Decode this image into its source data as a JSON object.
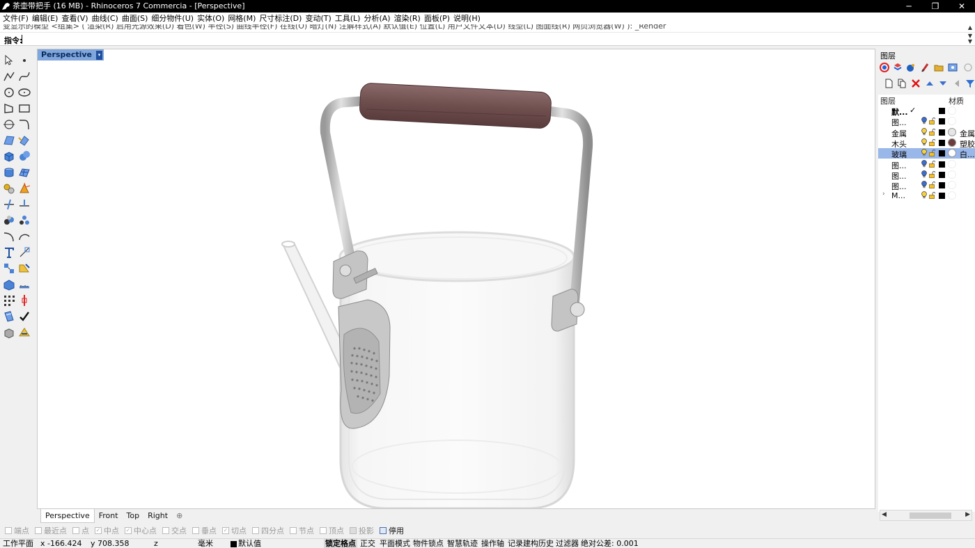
{
  "window": {
    "title": "茶壶带把手 (16 MB) - Rhinoceros 7 Commercia - [Perspective]",
    "controls": {
      "minimize": "─",
      "maximize": "❐",
      "close": "✕"
    }
  },
  "menu": [
    "文件(F)",
    "编辑(E)",
    "查看(V)",
    "曲线(C)",
    "曲面(S)",
    "细分物件(U)",
    "实体(O)",
    "网格(M)",
    "尺寸标注(D)",
    "变动(T)",
    "工具(L)",
    "分析(A)",
    "渲染(R)",
    "面板(P)",
    "说明(H)"
  ],
  "command": {
    "history": "变显示的模型 <组集> ( 渲染(R) 启用光源效果(D) 着色(W) 半径(S) 曲线半径(F) 在线(O) 暗灯(N) 注解样式(A) 默认值(E) 位置(L) 用户文件文本(D) 线型(L) 图面线(R) 网页浏览器(W) ): _Render",
    "prompt_label": "指令:"
  },
  "viewport": {
    "name": "Perspective",
    "menu_arrow": "▾"
  },
  "viewport_tabs": {
    "tabs": [
      "Perspective",
      "Front",
      "Top",
      "Right"
    ],
    "add": "⊕"
  },
  "osnap": [
    {
      "label": "端点",
      "checked": false
    },
    {
      "label": "最近点",
      "checked": false
    },
    {
      "label": "点",
      "checked": false
    },
    {
      "label": "中点",
      "checked": true
    },
    {
      "label": "中心点",
      "checked": true
    },
    {
      "label": "交点",
      "checked": false
    },
    {
      "label": "垂点",
      "checked": false
    },
    {
      "label": "切点",
      "checked": true
    },
    {
      "label": "四分点",
      "checked": false
    },
    {
      "label": "节点",
      "checked": false
    },
    {
      "label": "顶点",
      "checked": false
    },
    {
      "label": "投影",
      "checked": false
    },
    {
      "label": "停用",
      "checked": false,
      "enabled": true
    }
  ],
  "status": {
    "cplane": "工作平面",
    "x": "x -166.424",
    "y": "y 708.358",
    "z": "z",
    "unit": "毫米",
    "layer": "默认值",
    "toggles": [
      "锁定格点",
      "正交",
      "平面模式",
      "物件锁点",
      "智慧轨迹",
      "操作轴",
      "记录建构历史",
      "过滤器"
    ],
    "active_toggle": "锁定格点",
    "tolerance": "绝对公差: 0.001"
  },
  "layers_panel": {
    "title": "图层",
    "col_layer": "图层",
    "col_material": "材质",
    "layers": [
      {
        "name": "默...",
        "current": true,
        "check": "✓",
        "bulb_on": false,
        "color": "#000000",
        "material": "",
        "mat_color": "",
        "bold": true
      },
      {
        "name": "图...",
        "bulb_on": true,
        "color": "#000000",
        "material": "",
        "mat_color": ""
      },
      {
        "name": "金属",
        "bulb_on": false,
        "color": "#000000",
        "material": "金属",
        "mat_color": "#e6e6e6"
      },
      {
        "name": "木头",
        "bulb_on": false,
        "color": "#000000",
        "material": "塑胶",
        "mat_color": "#6b3c3c"
      },
      {
        "name": "玻璃",
        "bulb_on": false,
        "color": "#000000",
        "material": "白...",
        "mat_color": "#ffffff",
        "selected": true
      },
      {
        "name": "图...",
        "bulb_on": true,
        "color": "#000000",
        "material": "",
        "mat_color": ""
      },
      {
        "name": "图...",
        "bulb_on": true,
        "color": "#000000",
        "material": "",
        "mat_color": ""
      },
      {
        "name": "图...",
        "bulb_on": true,
        "color": "#000000",
        "material": "",
        "mat_color": ""
      },
      {
        "name": "M...",
        "bulb_on": false,
        "color": "#000000",
        "material": "",
        "mat_color": "",
        "expandable": true,
        "expander": "›"
      }
    ]
  }
}
